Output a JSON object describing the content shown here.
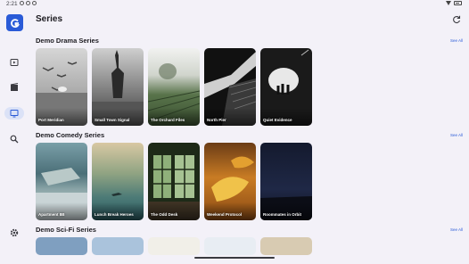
{
  "status": {
    "time": "2:21"
  },
  "page": {
    "title": "Series"
  },
  "sections": [
    {
      "title": "Demo Drama Series",
      "see_all": "See All",
      "items": [
        "Port Meridian",
        "Small Town Signal",
        "The Orchard Files",
        "North Pier",
        "Quiet Evidence"
      ]
    },
    {
      "title": "Demo Comedy Series",
      "see_all": "See All",
      "items": [
        "Apartment 8B",
        "Lunch Break Heroes",
        "The Odd Desk",
        "Weekend Protocol",
        "Roommates in Orbit"
      ]
    },
    {
      "title": "Demo Sci-Fi Series",
      "see_all": "See All",
      "items": []
    }
  ],
  "nav": [
    "play-icon",
    "movie-icon",
    "tv-icon",
    "search-icon",
    "settings-icon"
  ],
  "colors": {
    "accent": "#2a5bd7",
    "background": "#f3f1f8"
  }
}
